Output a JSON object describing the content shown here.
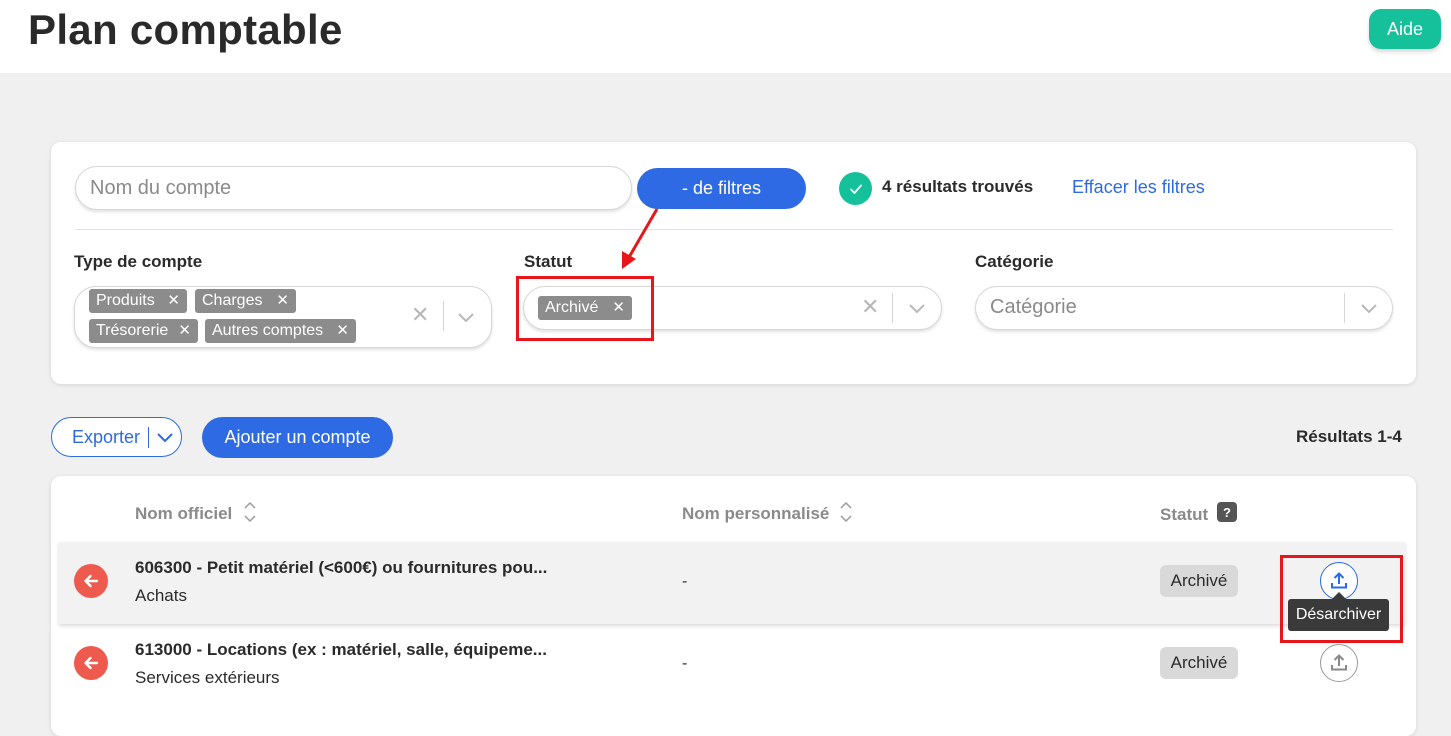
{
  "header": {
    "title": "Plan comptable",
    "help_label": "Aide"
  },
  "filters": {
    "search_placeholder": "Nom du compte",
    "toggle_label": "- de filtres",
    "results_found": "4 résultats trouvés",
    "clear_label": "Effacer les filtres",
    "account_type": {
      "label": "Type de compte",
      "chips": [
        "Produits",
        "Charges",
        "Trésorerie",
        "Autres comptes"
      ]
    },
    "status": {
      "label": "Statut",
      "chips": [
        "Archivé"
      ]
    },
    "category": {
      "label": "Catégorie",
      "placeholder": "Catégorie"
    }
  },
  "toolbar": {
    "export_label": "Exporter",
    "add_label": "Ajouter un compte",
    "results_range": "Résultats 1-4"
  },
  "table": {
    "columns": [
      "Nom officiel",
      "Nom personnalisé",
      "Statut"
    ],
    "help_badge": "?",
    "rows": [
      {
        "name": "606300 - Petit matériel (<600€) ou fournitures pou...",
        "category": "Achats",
        "custom_name": "-",
        "status": "Archivé"
      },
      {
        "name": "613000 - Locations (ex : matériel, salle, équipeme...",
        "category": "Services extérieurs",
        "custom_name": "-",
        "status": "Archivé"
      }
    ],
    "tooltip": "Désarchiver"
  },
  "colors": {
    "accent": "#2d6ae3",
    "success": "#14c19a",
    "danger": "#ef5a4e",
    "annotation": "#e8161b"
  },
  "icons": [
    "check-icon",
    "clear-icon",
    "chevron-down-icon",
    "sort-icon",
    "arrow-left-icon",
    "upload-icon"
  ]
}
